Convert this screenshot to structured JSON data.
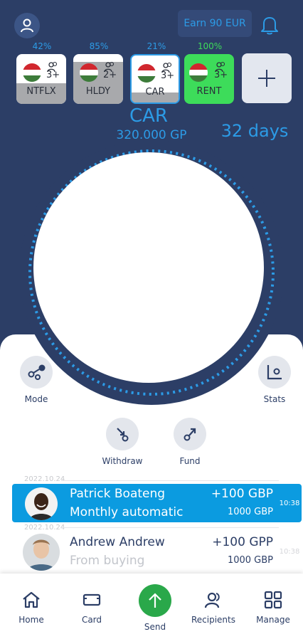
{
  "header": {
    "earn_label": "Earn 90 EUR"
  },
  "goals": [
    {
      "pct": "42%",
      "members": "3+",
      "label": "NTFLX",
      "fill": 0.42
    },
    {
      "pct": "85%",
      "members": "2+",
      "label": "HLDY",
      "fill": 0.85
    },
    {
      "pct": "21%",
      "members": "3+",
      "label": "CAR",
      "fill": 0.21
    },
    {
      "pct": "100%",
      "members": "3+",
      "label": "RENT",
      "fill": 1.0
    }
  ],
  "selected_goal": {
    "name": "CAR",
    "amount": "320.000 GP",
    "days": "32 days"
  },
  "actions": {
    "mode": "Mode",
    "stats": "Stats",
    "withdraw": "Withdraw",
    "fund": "Fund"
  },
  "transactions": [
    {
      "date": "2022.10.24",
      "name": "Patrick Boateng",
      "desc": "Monthly automatic",
      "amount": "+100 GBP",
      "balance": "1000 GBP",
      "time": "10:38"
    },
    {
      "date": "2022.10.24",
      "name": "Andrew Andrew",
      "desc": "From buying",
      "amount": "+100 GPP",
      "balance": "1000 GBP",
      "time": "10:38"
    }
  ],
  "nav": {
    "home": "Home",
    "card": "Card",
    "send": "Send",
    "recipients": "Recipients",
    "manage": "Manage"
  },
  "colors": {
    "accent": "#2c9be6",
    "background": "#2c3e66",
    "highlight": "#0b9be0",
    "send": "#2aa84a",
    "complete": "#3ddc5a"
  }
}
